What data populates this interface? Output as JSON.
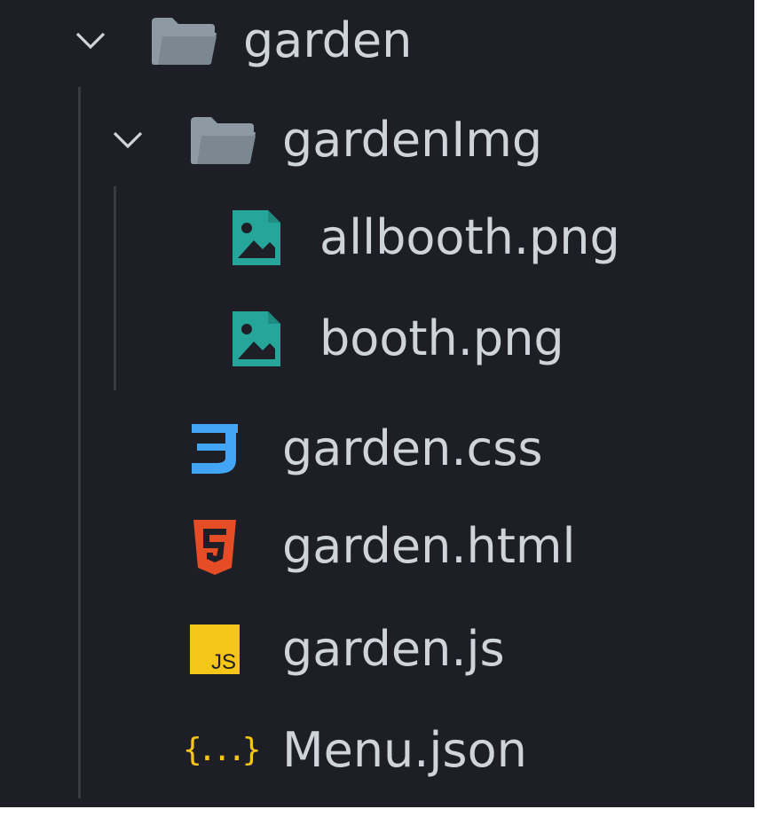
{
  "explorer": {
    "items": [
      {
        "label": "garden",
        "type": "folder",
        "expanded": true,
        "depth": 0,
        "icon": "folder-open-icon"
      },
      {
        "label": "gardenImg",
        "type": "folder",
        "expanded": true,
        "depth": 1,
        "icon": "folder-open-icon"
      },
      {
        "label": "allbooth.png",
        "type": "file",
        "depth": 2,
        "icon": "image-file-icon"
      },
      {
        "label": "booth.png",
        "type": "file",
        "depth": 2,
        "icon": "image-file-icon"
      },
      {
        "label": "garden.css",
        "type": "file",
        "depth": 1,
        "icon": "css-file-icon"
      },
      {
        "label": "garden.html",
        "type": "file",
        "depth": 1,
        "icon": "html-file-icon"
      },
      {
        "label": "garden.js",
        "type": "file",
        "depth": 1,
        "icon": "js-file-icon",
        "badge": "JS"
      },
      {
        "label": "Menu.json",
        "type": "file",
        "depth": 1,
        "icon": "json-file-icon",
        "badge": "{...}"
      }
    ]
  },
  "colors": {
    "background": "#1e1f26",
    "text": "#cfd3da",
    "folder": "#8d9aa3",
    "image": "#26a69a",
    "css": "#42a5f5",
    "html": "#e44d26",
    "js": "#f5c518",
    "json": "#f5c518"
  }
}
